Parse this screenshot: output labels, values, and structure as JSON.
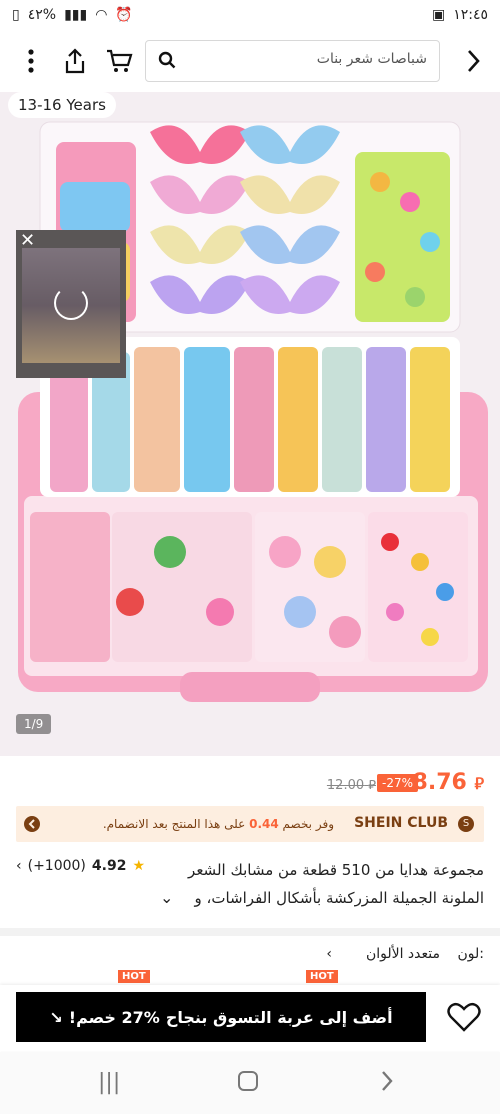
{
  "status_bar": {
    "time": "١٢:٤٥",
    "battery": "٤٢%"
  },
  "header": {
    "search_placeholder": "شباصات شعر بنات"
  },
  "hero": {
    "age_badge": "13-16 Years",
    "page_counter": "1/9"
  },
  "price": {
    "current": "8.76",
    "discount": "-27%",
    "original": "12.00",
    "currency": "⃁"
  },
  "club": {
    "label": "SHEIN CLUB",
    "desc_prefix": "وفر بخصم",
    "amount": "0.44",
    "desc_suffix": "على هذا المنتج بعد الانضمام."
  },
  "product": {
    "title": "مجموعة هدايا من 510 قطعة من مشابك الشعر الملونة الجميلة المزركشة بأشكال الفراشات، و",
    "rating": "4.92",
    "reviews": "(+1000)"
  },
  "color": {
    "label": "لون:",
    "value": "متعدد الألوان"
  },
  "swatch_badges": [
    "HOT",
    "HOT"
  ],
  "action": {
    "cart_label": "أضف إلى عربة التسوق بنجاح",
    "promo": "27% خصم!"
  },
  "colors": {
    "accent": "#fa6338",
    "club_bg": "#fdeee0",
    "club_text": "#7a3f12"
  }
}
